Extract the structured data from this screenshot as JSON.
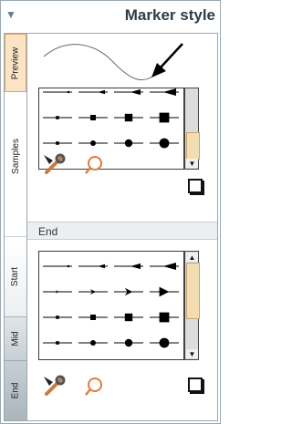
{
  "header": {
    "title": "Marker style"
  },
  "tabs": [
    {
      "id": "preview",
      "label": "Preview"
    },
    {
      "id": "samples",
      "label": "Samples"
    },
    {
      "id": "start",
      "label": "Start"
    },
    {
      "id": "mid",
      "label": "Mid"
    },
    {
      "id": "end",
      "label": "End"
    }
  ],
  "sections": {
    "end_label": "End"
  },
  "icons": {
    "collapse": "triangle-down-icon",
    "tools": "wrench-screwdriver-icon",
    "search": "magnifier-icon",
    "square": "square-icon"
  },
  "colors": {
    "accent": "#fbe3c6",
    "accent_border": "#e0a866",
    "search_icon": "#e07b3c"
  }
}
